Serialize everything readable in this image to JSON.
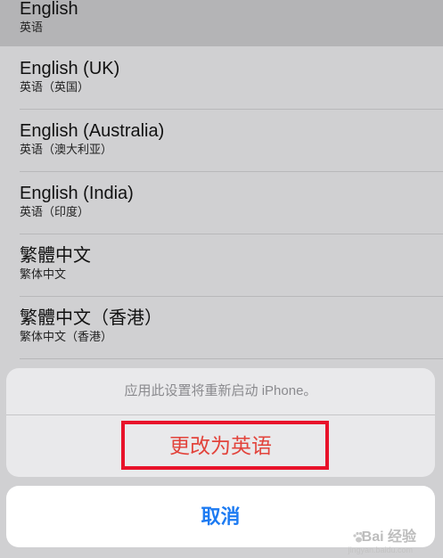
{
  "languages": [
    {
      "name": "English",
      "native": "英语",
      "selected": true
    },
    {
      "name": "English (UK)",
      "native": "英语（英国）"
    },
    {
      "name": "English (Australia)",
      "native": "英语（澳大利亚）"
    },
    {
      "name": "English (India)",
      "native": "英语（印度）"
    },
    {
      "name": "繁體中文",
      "native": "繁体中文"
    },
    {
      "name": "繁體中文（香港）",
      "native": "繁体中文（香港）"
    }
  ],
  "sheet": {
    "message": "应用此设置将重新启动 iPhone。",
    "action": "更改为英语"
  },
  "cancel_label": "取消",
  "watermark": {
    "text": "Bai 经验",
    "sub": "jingyan.baidu.com"
  },
  "colors": {
    "action_red": "#e2433b",
    "cancel_blue": "#1d7bf2",
    "highlight_box": "#e8122a"
  }
}
